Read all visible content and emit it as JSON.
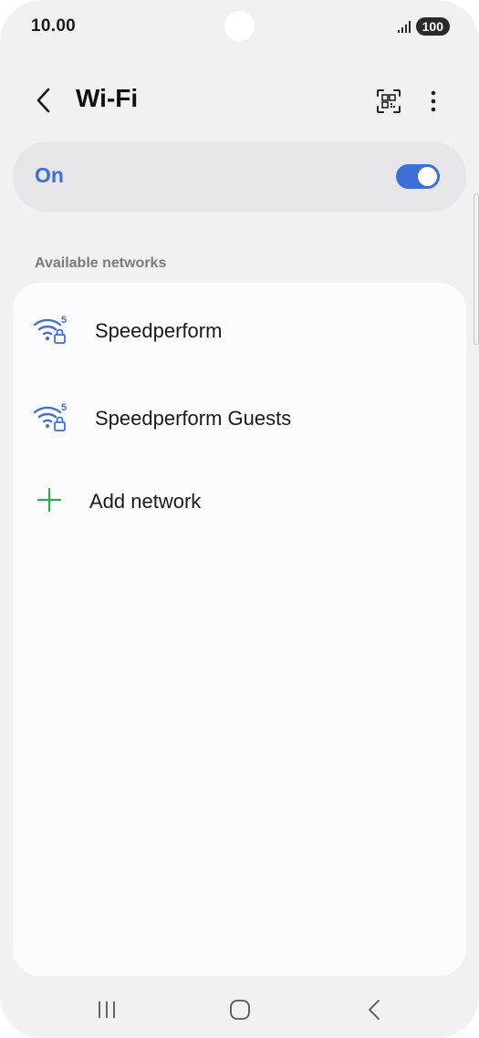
{
  "status_bar": {
    "time": "10.00",
    "battery": "100",
    "icons": [
      "camera-hole",
      "signal-icon",
      "battery-icon"
    ]
  },
  "header": {
    "title": "Wi-Fi",
    "icons": [
      "back-arrow-icon",
      "qr-code-scan-icon",
      "more-options-icon"
    ]
  },
  "wifi_toggle": {
    "label": "On",
    "state": true
  },
  "available_networks": {
    "section_label": "Available networks",
    "networks": [
      {
        "name": "Speedperform",
        "icon": "wifi-5ghz-locked-icon"
      },
      {
        "name": "Speedperform Guests",
        "icon": "wifi-5ghz-locked-icon"
      }
    ],
    "add_network_label": "Add network"
  },
  "nav_bar": {
    "icons": [
      "recent-apps-icon",
      "home-icon",
      "back-icon"
    ]
  },
  "colors": {
    "accent": "#3e6fd8",
    "add_icon": "#2eaa4f",
    "background": "#f1f1f3",
    "card": "#fcfcfe",
    "toggle_card": "#e5e5ea"
  }
}
